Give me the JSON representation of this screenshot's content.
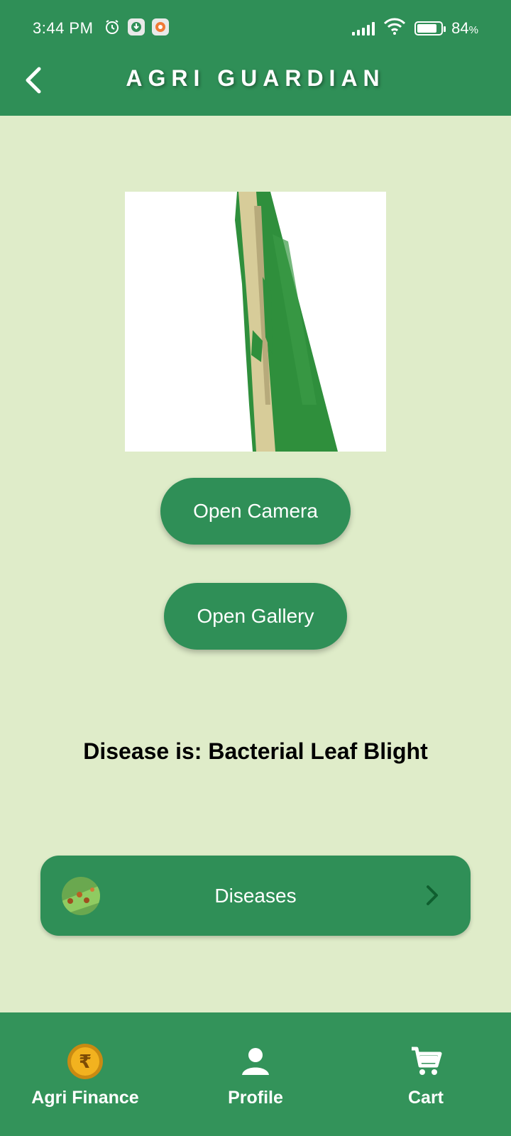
{
  "status_bar": {
    "time": "3:44 PM",
    "battery": "84",
    "battery_unit": "%",
    "battery_level": 0.84
  },
  "header": {
    "title": "AGRI GUARDIAN"
  },
  "actions": {
    "open_camera": "Open Camera",
    "open_gallery": "Open Gallery"
  },
  "result": {
    "text": "Disease is: Bacterial Leaf Blight"
  },
  "diseases_card": {
    "label": "Diseases"
  },
  "bottom_nav": {
    "items": [
      {
        "label": "Agri Finance",
        "icon": "rupee-coin-icon"
      },
      {
        "label": "Profile",
        "icon": "person-icon"
      },
      {
        "label": "Cart",
        "icon": "cart-icon"
      }
    ]
  },
  "colors": {
    "primary": "#2f8f57",
    "background": "#dfecc9",
    "white": "#ffffff"
  }
}
